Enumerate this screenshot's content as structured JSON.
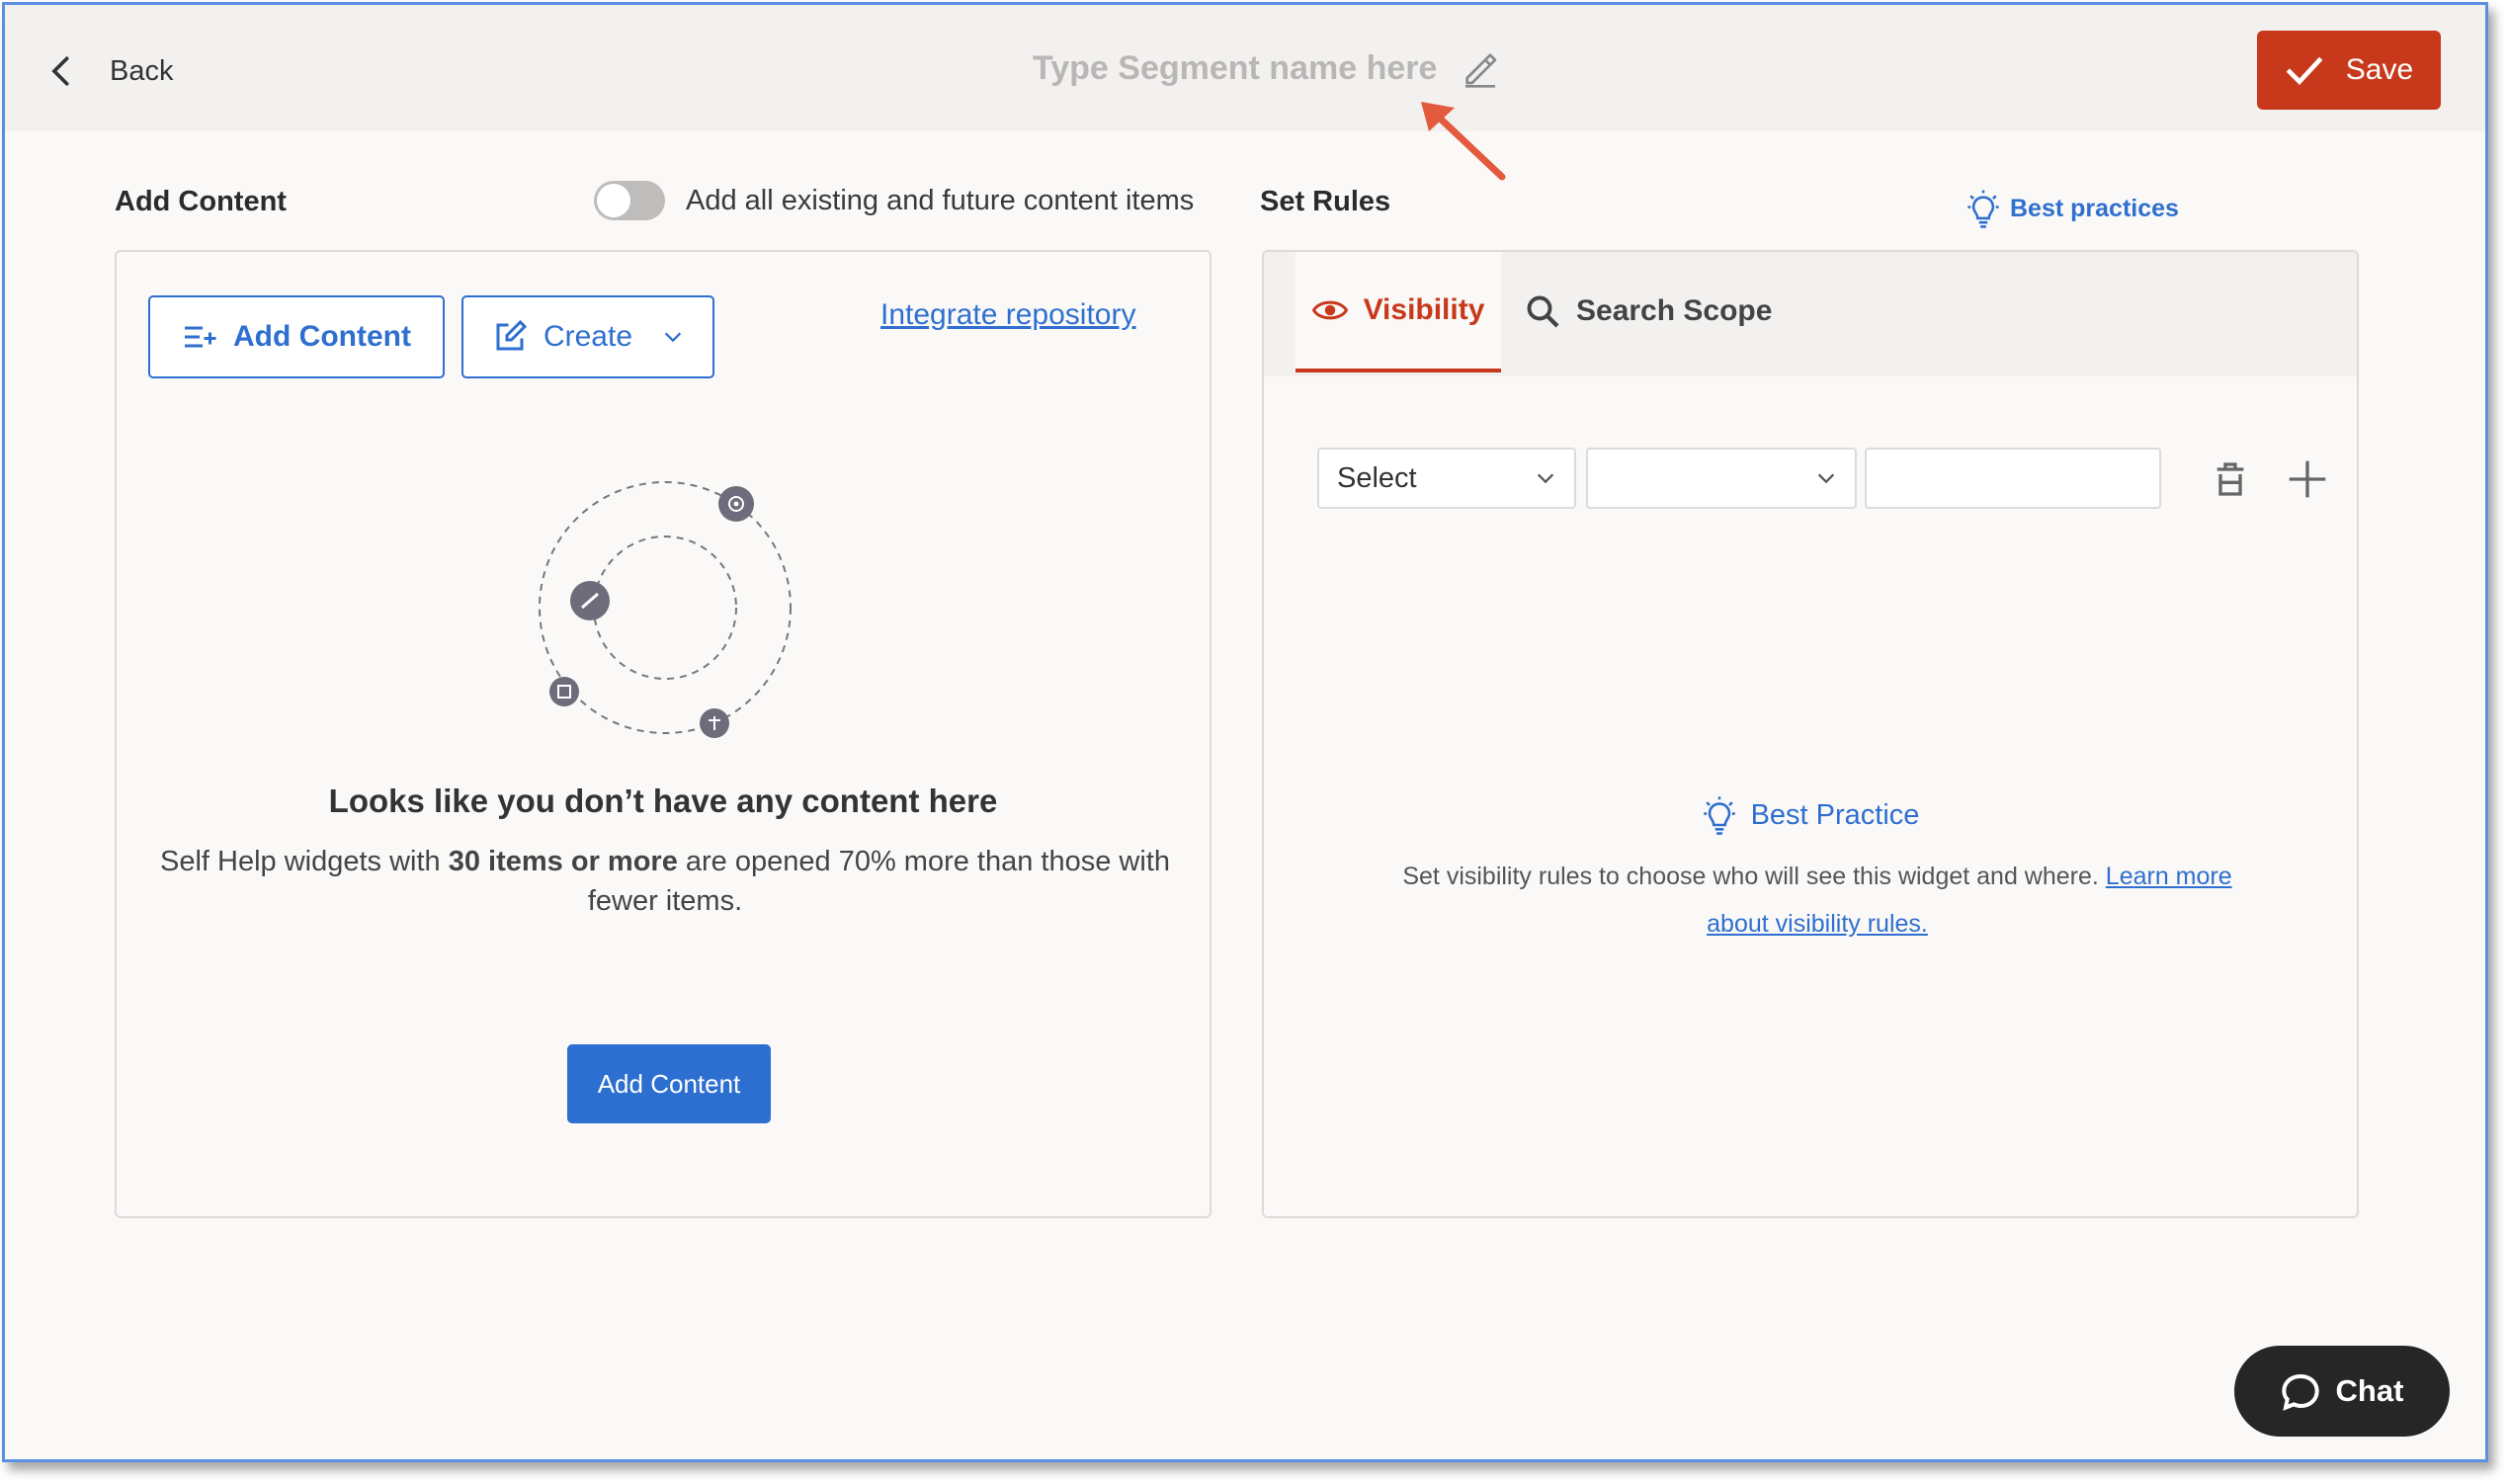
{
  "header": {
    "back_label": "Back",
    "title_placeholder": "Type Segment name here",
    "save_label": "Save"
  },
  "add_content_section": {
    "heading": "Add Content",
    "toggle_label": "Add all existing and future content items",
    "toggle_on": false,
    "add_content_button": "Add Content",
    "create_button": "Create",
    "integrate_link": "Integrate repository",
    "empty_title": "Looks like you don’t have any content here",
    "empty_desc_pre": "Self Help widgets with ",
    "empty_desc_bold": "30 items or more",
    "empty_desc_post": " are opened 70% more than those with fewer items.",
    "primary_button": "Add Content"
  },
  "rules_section": {
    "heading": "Set Rules",
    "best_practices_link": "Best practices",
    "tabs": [
      {
        "label": "Visibility",
        "active": true
      },
      {
        "label": "Search Scope",
        "active": false
      }
    ],
    "rule_row": {
      "field_select": "Select",
      "operator_select": "",
      "value_input": ""
    },
    "best_practice_title": "Best Practice",
    "best_practice_text": "Set visibility rules to choose who will see this widget and where. ",
    "best_practice_link": "Learn more about visibility rules."
  },
  "chat_label": "Chat",
  "colors": {
    "save_red": "#c8391b",
    "link_blue": "#2f6fcf",
    "chat_dark": "#262626"
  }
}
